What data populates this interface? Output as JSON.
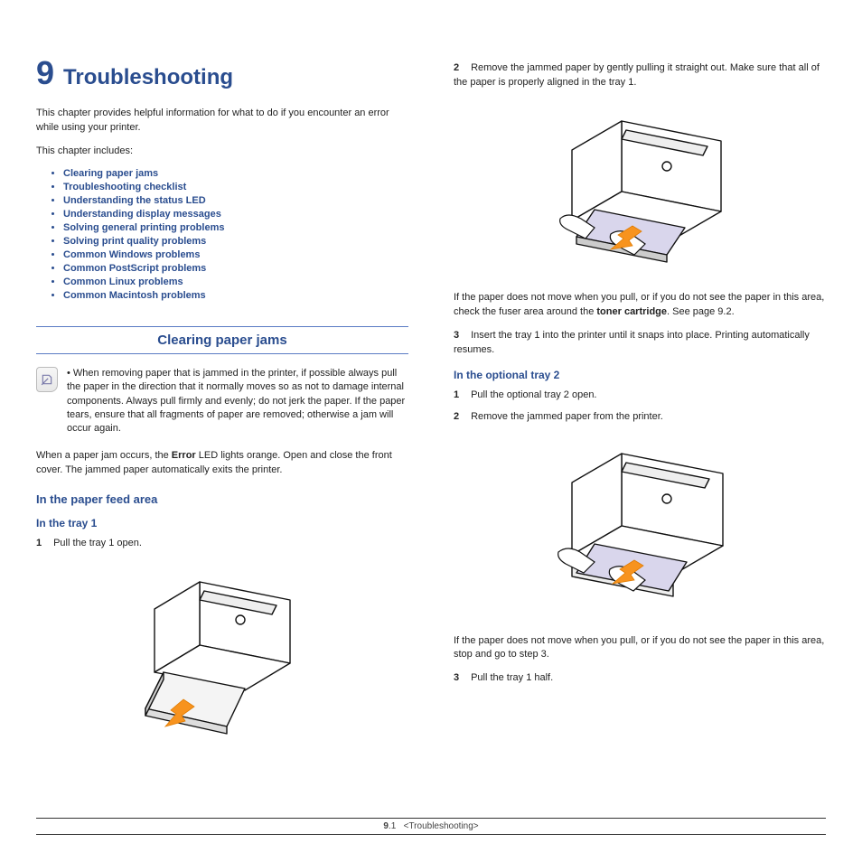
{
  "chapter": {
    "number": "9",
    "title": "Troubleshooting",
    "intro": "This chapter provides helpful information for what to do if you encounter an error while using your printer.",
    "includes_label": "This chapter includes:",
    "toc": [
      "Clearing paper jams",
      "Troubleshooting checklist",
      "Understanding the status LED",
      "Understanding display messages",
      "Solving general printing problems",
      "Solving print quality problems",
      "Common Windows problems",
      "Common PostScript problems",
      "Common Linux problems",
      "Common Macintosh problems"
    ]
  },
  "section": {
    "heading": "Clearing paper jams",
    "note": "When removing paper that is jammed in the printer, if possible always pull the paper in the direction that it normally moves so as not to damage internal components. Always pull firmly and evenly; do not jerk the paper. If the paper tears, ensure that all fragments of paper are removed; otherwise a jam will occur again.",
    "led_sentence_1": "When a paper jam occurs, the ",
    "led_sentence_bold": "Error",
    "led_sentence_2": " LED lights orange. Open and close the front cover. The jammed paper automatically exits the printer.",
    "sub1": "In the paper feed area",
    "sub1a": "In the tray 1",
    "step1_num": "1",
    "step1_text": "Pull the tray 1 open.",
    "right_step2_num": "2",
    "right_step2_text": "Remove the jammed paper by gently pulling it straight out. Make sure that all of the paper is properly aligned in the tray 1.",
    "right_p_nosee_1": "If the paper does not move when you pull, or if you do not see the paper in this area, check the fuser area around the ",
    "right_p_nosee_bold": "toner cartridge",
    "right_p_nosee_2": ". See page 9.2.",
    "right_step3_num": "3",
    "right_step3_text": "Insert the tray 1 into the printer until it snaps into place. Printing automatically resumes.",
    "sub2": "In the optional tray 2",
    "opt_step1_num": "1",
    "opt_step1_text": "Pull the optional tray 2 open.",
    "opt_step2_num": "2",
    "opt_step2_text": "Remove the jammed paper from the printer.",
    "opt_nosee": "If the paper does not move when you pull, or if you do not see the paper in this area, stop and go to step 3.",
    "opt_step3_num": "3",
    "opt_step3_text": "Pull the tray 1 half."
  },
  "footer": {
    "page_big": "9",
    "page_small": ".1",
    "crumb": "<Troubleshooting>"
  }
}
